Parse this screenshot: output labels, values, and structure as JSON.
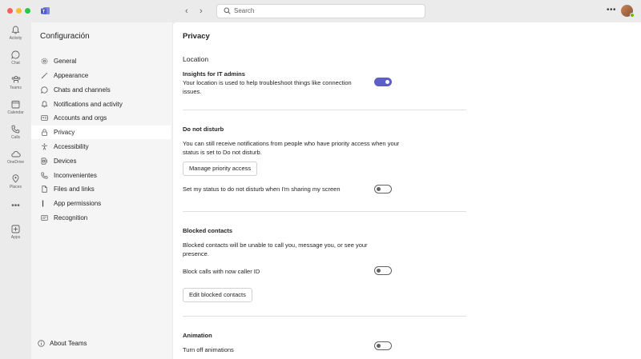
{
  "titlebar": {
    "search_placeholder": "Search",
    "more_icon": "ellipsis-icon"
  },
  "rail": {
    "items": [
      {
        "label": "Activity",
        "icon": "bell-icon"
      },
      {
        "label": "Chat",
        "icon": "chat-icon"
      },
      {
        "label": "Teams",
        "icon": "teams-icon"
      },
      {
        "label": "Calendar",
        "icon": "calendar-icon"
      },
      {
        "label": "Calls",
        "icon": "phone-icon"
      },
      {
        "label": "OneDrive",
        "icon": "cloud-icon"
      },
      {
        "label": "Places",
        "icon": "location-pin-icon"
      }
    ],
    "more": "•••",
    "apps": {
      "label": "Apps",
      "icon": "apps-icon"
    }
  },
  "sidebar": {
    "title": "Configuración",
    "items": [
      {
        "label": "General",
        "icon": "gear-icon"
      },
      {
        "label": "Appearance",
        "icon": "magic-wand-icon"
      },
      {
        "label": "Chats and channels",
        "icon": "chat-icon"
      },
      {
        "label": "Notifications and activity",
        "icon": "bell-icon"
      },
      {
        "label": "Accounts and orgs",
        "icon": "id-card-icon"
      },
      {
        "label": "Privacy",
        "icon": "lock-icon",
        "active": true
      },
      {
        "label": "Accessibility",
        "icon": "accessibility-icon"
      },
      {
        "label": "Devices",
        "icon": "devices-icon"
      },
      {
        "label": "Inconvenientes",
        "icon": "phone-icon"
      },
      {
        "label": "Files and links",
        "icon": "file-icon"
      },
      {
        "label": "App permissions",
        "icon": "bar-icon"
      },
      {
        "label": "Recognition",
        "icon": "recognition-icon"
      }
    ],
    "about": "About Teams"
  },
  "content": {
    "page_title": "Privacy",
    "location": {
      "section": "Location",
      "insights_title": "Insights for IT admins",
      "insights_desc": "Your location is used to help troubleshoot things like connection issues.",
      "insights_on": true
    },
    "dnd": {
      "section": "Do not disturb",
      "desc": "You can still receive notifications from people who have priority access when your status is set to Do not disturb.",
      "manage_button": "Manage priority access",
      "sharing_label": "Set my status to do not disturb when I'm sharing my screen",
      "sharing_on": false
    },
    "blocked": {
      "section": "Blocked contacts",
      "desc": "Blocked contacts will be unable to call you, message you, or see your presence.",
      "block_calls_label": "Block calls with now caller ID",
      "block_calls_on": false,
      "edit_button": "Edit blocked contacts"
    },
    "animation": {
      "section": "Animation",
      "turn_off_label": "Turn off animations",
      "turn_off_on": false
    }
  },
  "colors": {
    "accent": "#5b5fc7",
    "window_bg": "#ebebeb",
    "sidebar_bg": "#f5f5f5",
    "content_bg": "#ffffff"
  }
}
